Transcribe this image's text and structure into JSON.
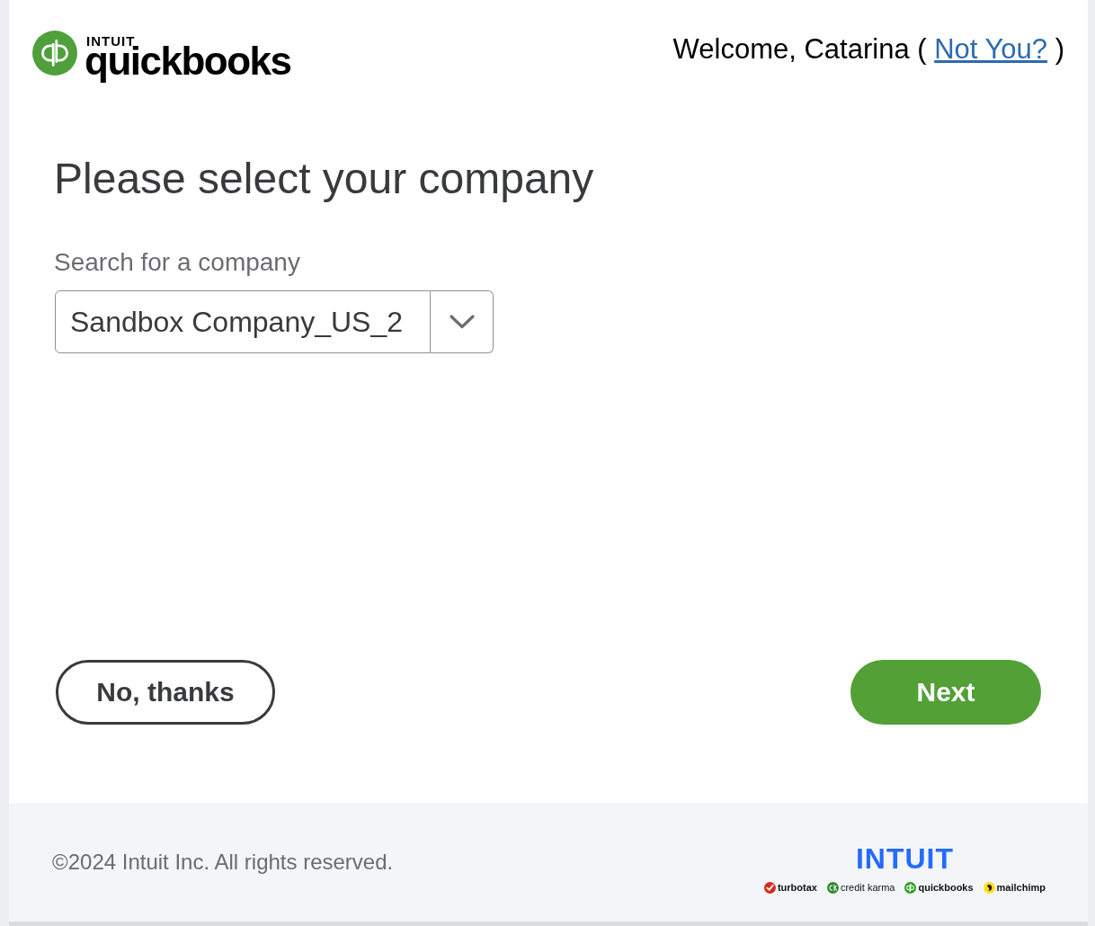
{
  "header": {
    "logo": {
      "company": "INTUIT",
      "product": "quickbooks"
    },
    "welcome": {
      "text": "Welcome, Catarina (",
      "link": "Not You?",
      "closing": ")"
    }
  },
  "main": {
    "heading": "Please select your company",
    "company_select": {
      "label": "Search for a company",
      "value": "Sandbox Company_US_2"
    }
  },
  "actions": [
    {
      "label": "No, thanks",
      "kind": "secondary"
    },
    {
      "label": "Next",
      "kind": "primary"
    }
  ],
  "footer": {
    "copyright": "©2024 Intuit Inc. All rights reserved.",
    "intuit_logo": "INTUIT",
    "brands": [
      {
        "name": "turbotax",
        "kind": "check",
        "color": "#d52b1e"
      },
      {
        "name": "credit karma",
        "kind": "ring",
        "color": "#2e8b2e"
      },
      {
        "name": "quickbooks",
        "kind": "qb",
        "color": "#2ca01c"
      },
      {
        "name": "mailchimp",
        "kind": "monkey",
        "color": "#ffe01b"
      }
    ]
  }
}
